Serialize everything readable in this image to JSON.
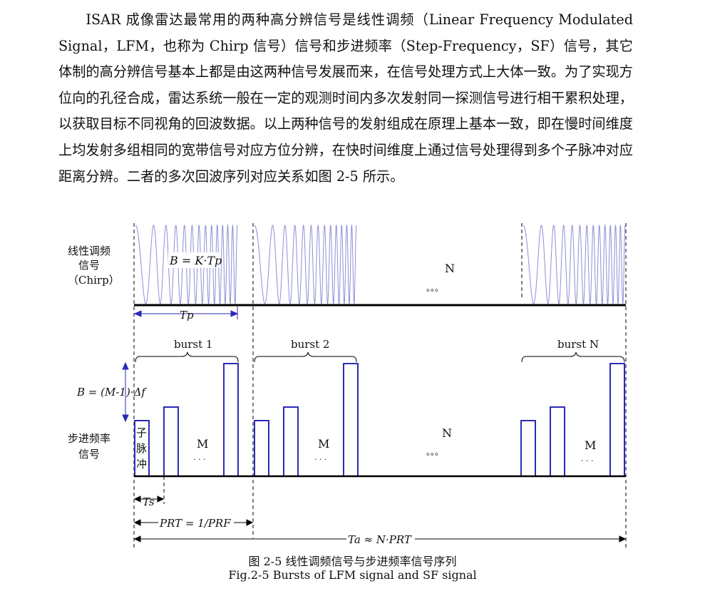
{
  "paragraph": "ISAR 成像雷达最常用的两种高分辨信号是线性调频（Linear Frequency Modulated Signal，LFM，也称为 Chirp 信号）信号和步进频率（Step-Frequency，SF）信号，其它体制的高分辨信号基本上都是由这两种信号发展而来，在信号处理方式上大体一致。为了实现方位向的孔径合成，雷达系统一般在一定的观测时间内多次发射同一探测信号进行相干累积处理，以获取目标不同视角的回波数据。以上两种信号的发射组成在原理上基本一致，即在慢时间维度上均发射多组相同的宽带信号对应方位分辨，在快时间维度上通过信号处理得到多个子脉冲对应距离分辨。二者的多次回波序列对应关系如图 2-5 所示。",
  "figure": {
    "chirp_label": [
      "线性调频",
      "信号",
      "（Chirp）"
    ],
    "sf_label": [
      "步进频率",
      "信号"
    ],
    "bandwidth_chirp": "B = K·Tp",
    "bandwidth_sf": "B = (M-1)·Δf",
    "tp": "Tp",
    "ts": "Ts",
    "prt": "PRT = 1/PRF",
    "ta": "Ta ≈ N·PRT",
    "burst1": "burst 1",
    "burst2": "burst 2",
    "burstN": "burst N",
    "n_upper": "N",
    "n_lower": "N",
    "m_label": "M",
    "subpulse": [
      "子",
      "脉",
      "冲"
    ],
    "dots_small": "。。。",
    "dots_m": "· · ·",
    "colors": {
      "signal": "#2b2bb8",
      "chirp": "#8e8ed8",
      "axis": "#000000"
    }
  },
  "caption_zh": "图 2-5  线性调频信号与步进频率信号序列",
  "caption_en": "Fig.2-5 Bursts of LFM signal and SF signal"
}
